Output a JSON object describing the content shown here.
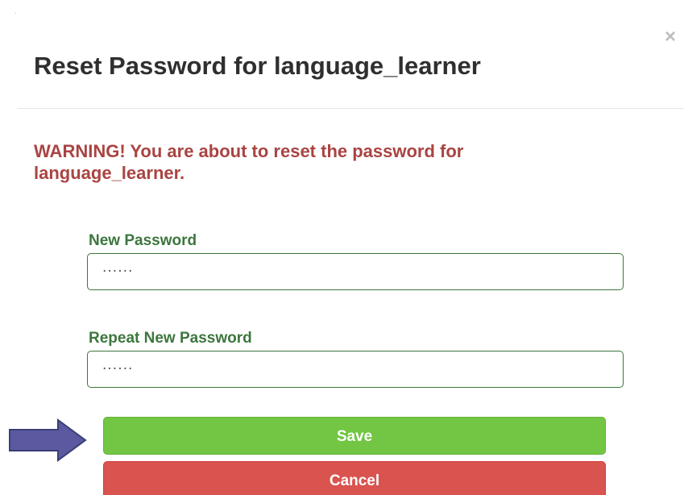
{
  "dialog": {
    "title": "Reset Password for language_learner",
    "close_symbol": "×",
    "warning": "WARNING! You are about to reset the password for language_learner."
  },
  "form": {
    "new_password": {
      "label": "New Password",
      "value": "······"
    },
    "repeat_password": {
      "label": "Repeat New Password",
      "value": "······"
    }
  },
  "buttons": {
    "save_label": "Save",
    "cancel_label": "Cancel"
  },
  "annotation": {
    "icon": "right-arrow-icon",
    "color": "#5b5aa0"
  },
  "colors": {
    "warning": "#a94442",
    "label": "#3c763d",
    "save": "#72c643",
    "cancel": "#d9534f"
  }
}
